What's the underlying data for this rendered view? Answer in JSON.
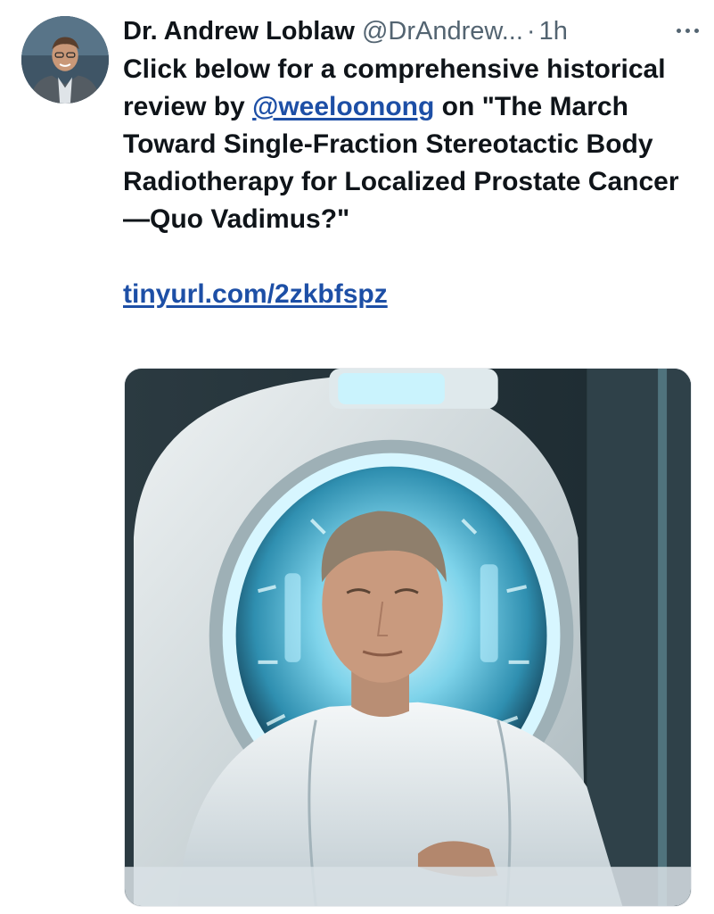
{
  "tweet": {
    "author_name": "Dr. Andrew Loblaw",
    "handle": "@DrAndrew...",
    "separator": "·",
    "time": "1h",
    "text_before_mention": "Click below for a comprehensive historical review by ",
    "mention": "@weeloonong",
    "text_after_mention": " on \"The March Toward Single-Fraction Stereotactic Body Radiotherapy for Localized Prostate Cancer—Quo Vadimus?\"",
    "link": "tinyurl.com/2zkbfspz"
  },
  "icons": {
    "more": "more-horizontal-icon"
  },
  "colors": {
    "text": "#0f1419",
    "secondary": "#536471",
    "link": "#1d4fa6",
    "glow": "#8fe3ff"
  }
}
